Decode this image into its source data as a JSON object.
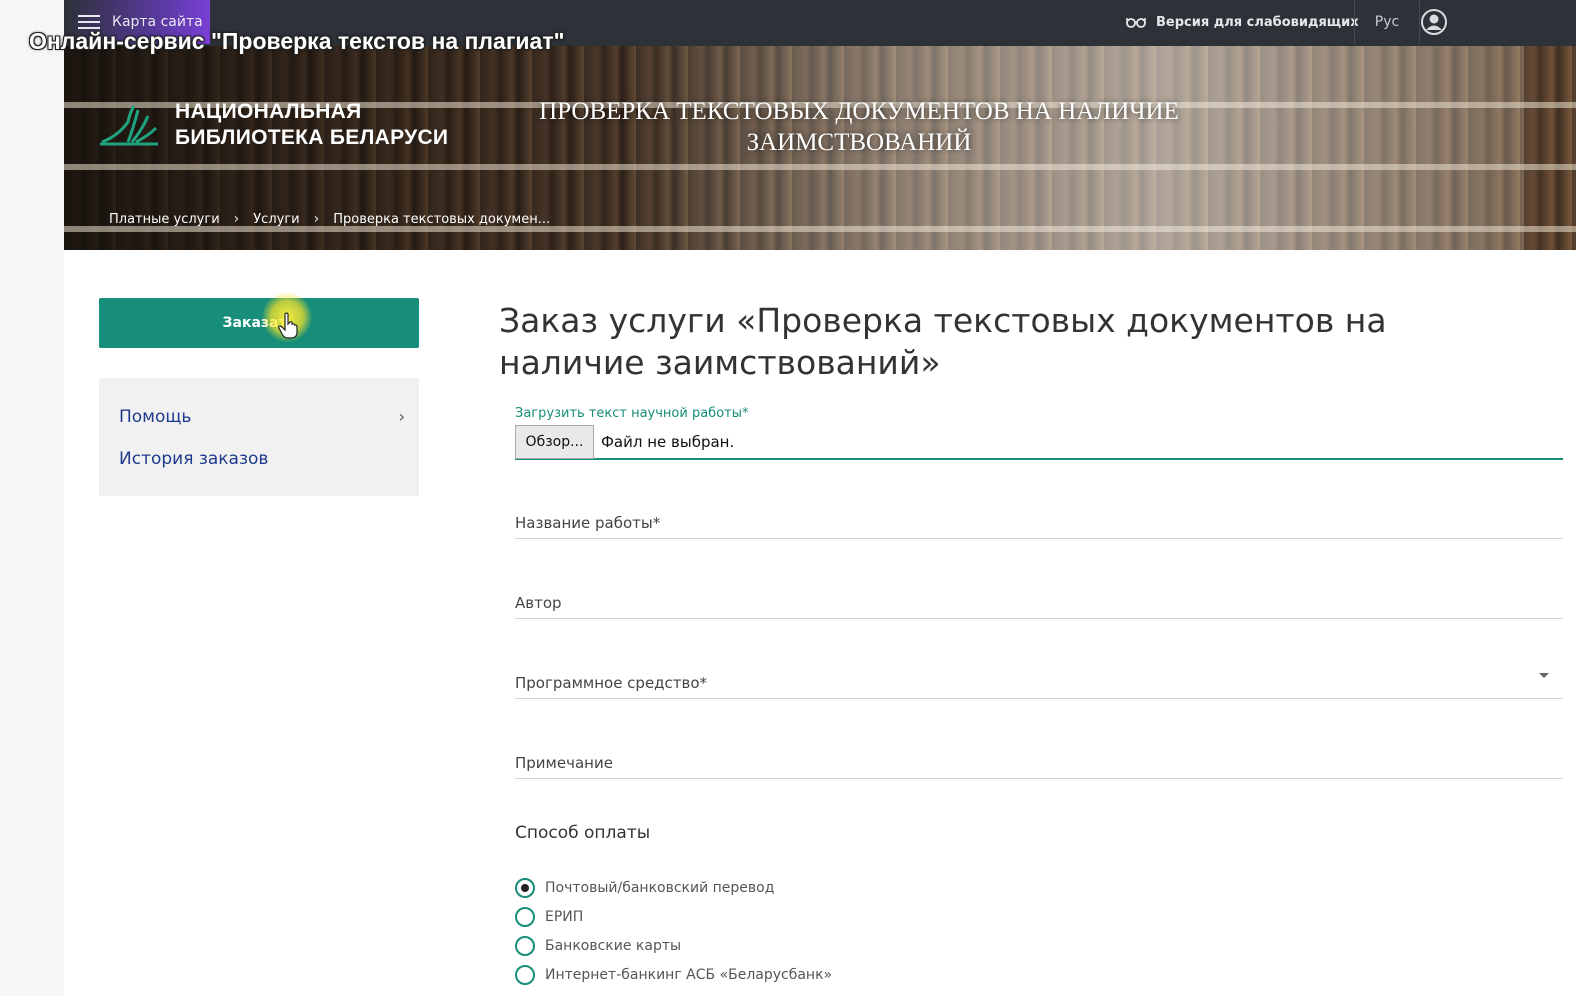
{
  "overlay": {
    "title": "Онлайн-сервис \"Проверка текстов на плагиат\""
  },
  "topbar": {
    "sitemap_label": "Карта сайта",
    "lowvision_label": "Версия для слабовидящих",
    "language": "Рус"
  },
  "banner": {
    "logo_line1": "НАЦИОНАЛЬНАЯ",
    "logo_line2": "БИБЛИОТЕКА БЕЛАРУСИ",
    "title_line1": "ПРОВЕРКА ТЕКСТОВЫХ ДОКУМЕНТОВ НА НАЛИЧИЕ",
    "title_line2": "ЗАИМСТВОВАНИЙ",
    "breadcrumb": [
      "Платные услуги",
      "Услуги",
      "Проверка текстовых докумен..."
    ]
  },
  "sidebar": {
    "order_button": "Заказать",
    "nav": [
      "Помощь",
      "История заказов"
    ]
  },
  "main": {
    "title": "Заказ услуги «Проверка текстовых документов на наличие заимствований»",
    "upload_label": "Загрузить текст научной работы*",
    "browse_button": "Обзор...",
    "file_status": "Файл не выбран.",
    "fields": {
      "work_title": "Название работы*",
      "author": "Автор",
      "software": "Программное средство*",
      "note": "Примечание"
    },
    "payment": {
      "title": "Способ оплаты",
      "options": [
        "Почтовый/банковский перевод",
        "ЕРИП",
        "Банковские карты",
        "Интернет-банкинг АСБ «Беларусбанк»"
      ],
      "selected": 0
    }
  },
  "colors": {
    "accent": "#168e79",
    "topbar": "#2d3138",
    "nav_link": "#1e3a8c"
  }
}
